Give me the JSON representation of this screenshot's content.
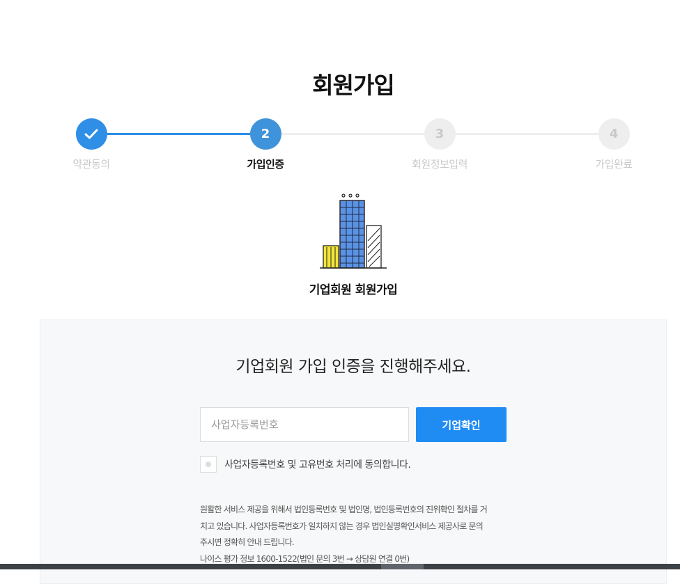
{
  "page": {
    "title": "회원가입"
  },
  "stepper": {
    "current_step": 2,
    "steps": [
      {
        "number": "✓",
        "label": "약관동의",
        "state": "done"
      },
      {
        "number": "2",
        "label": "가입인증",
        "state": "active"
      },
      {
        "number": "3",
        "label": "회원정보입력",
        "state": "todo"
      },
      {
        "number": "4",
        "label": "가입완료",
        "state": "todo"
      }
    ]
  },
  "member_type": {
    "caption": "기업회원 회원가입",
    "icon": "office-buildings-icon"
  },
  "verification": {
    "heading": "기업회원 가입 인증을 진행해주세요.",
    "business_number": {
      "value": "",
      "placeholder": "사업자등록번호"
    },
    "confirm_label": "기업확인",
    "consent_label": "사업자등록번호 및 고유번호 처리에 동의합니다.",
    "consent_checked": false,
    "notice_lines": [
      "원활한 서비스 제공을 위해서 법인등록번호 및 법인명, 법인등록번호의 진위확인 절차를 거",
      "치고 있습니다. 사업자등록번호가 일치하지 않는 경우 법인실명확인서비스 제공사로 문의",
      "주시면 정확히 안내 드립니다.",
      "나이스 평가 정보 1600-1522(법인 문의 3번 → 상담원 연결 0번)"
    ]
  },
  "colors": {
    "accent": "#1f8cf4",
    "step_done": "#2f8ee6",
    "inactive": "#c9c9c9"
  }
}
